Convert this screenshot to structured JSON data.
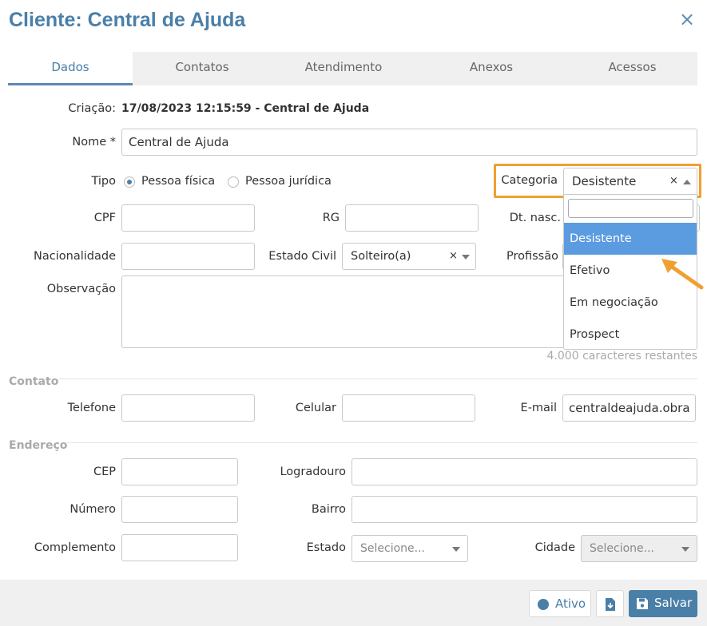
{
  "modal": {
    "title": "Cliente: Central de Ajuda",
    "close_icon": "×"
  },
  "tabs": [
    {
      "label": "Dados",
      "active": true
    },
    {
      "label": "Contatos",
      "active": false
    },
    {
      "label": "Atendimento",
      "active": false
    },
    {
      "label": "Anexos",
      "active": false
    },
    {
      "label": "Acessos",
      "active": false
    }
  ],
  "form": {
    "criacao_label": "Criação:",
    "criacao_value": "17/08/2023 12:15:59 - Central de Ajuda",
    "nome_label": "Nome *",
    "nome_value": "Central de Ajuda",
    "tipo_label": "Tipo",
    "tipo_options": [
      {
        "label": "Pessoa física",
        "selected": true
      },
      {
        "label": "Pessoa jurídica",
        "selected": false
      }
    ],
    "categoria_label": "Categoria",
    "categoria_value": "Desistente",
    "categoria_clear": "×",
    "cpf_label": "CPF",
    "rg_label": "RG",
    "dtnasc_label": "Dt. nasc.",
    "nacionalidade_label": "Nacionalidade",
    "estado_civil_label": "Estado Civil",
    "estado_civil_value": "Solteiro(a)",
    "estado_civil_clear": "×",
    "profissao_label": "Profissão",
    "observacao_label": "Observação",
    "char_count": "4.000 caracteres restantes"
  },
  "dropdown": {
    "search_value": "",
    "options": [
      "Desistente",
      "Efetivo",
      "Em negociação",
      "Prospect"
    ],
    "highlighted": 0
  },
  "contato": {
    "section_title": "Contato",
    "telefone_label": "Telefone",
    "celular_label": "Celular",
    "email_label": "E-mail",
    "email_value": "centraldeajuda.obra"
  },
  "endereco": {
    "section_title": "Endereço",
    "cep_label": "CEP",
    "logradouro_label": "Logradouro",
    "numero_label": "Número",
    "bairro_label": "Bairro",
    "complemento_label": "Complemento",
    "estado_label": "Estado",
    "estado_placeholder": "Selecione...",
    "cidade_label": "Cidade",
    "cidade_placeholder": "Selecione..."
  },
  "footer": {
    "ativo_label": "Ativo",
    "salvar_label": "Salvar"
  },
  "colors": {
    "accent": "#4a7fa8",
    "highlight": "#5b9be0",
    "callout": "#f0a030",
    "save_button": "#4a7fa8"
  }
}
